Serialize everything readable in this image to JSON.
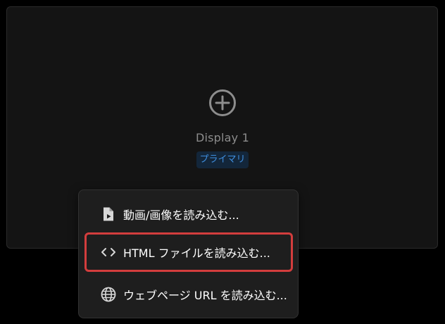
{
  "display": {
    "name": "Display 1",
    "badge": "プライマリ",
    "add_icon": "plus-circle-icon"
  },
  "menu": {
    "items": [
      {
        "label": "動画/画像を読み込む...",
        "icon": "file-media-icon"
      },
      {
        "label": "HTML ファイルを読み込む...",
        "icon": "code-icon",
        "highlighted": true
      },
      {
        "label": "ウェブページ URL を読み込む...",
        "icon": "globe-icon"
      }
    ]
  },
  "colors": {
    "highlight_border": "#d33d3d",
    "badge_text": "#3f8fe0",
    "badge_bg": "#13263a"
  }
}
